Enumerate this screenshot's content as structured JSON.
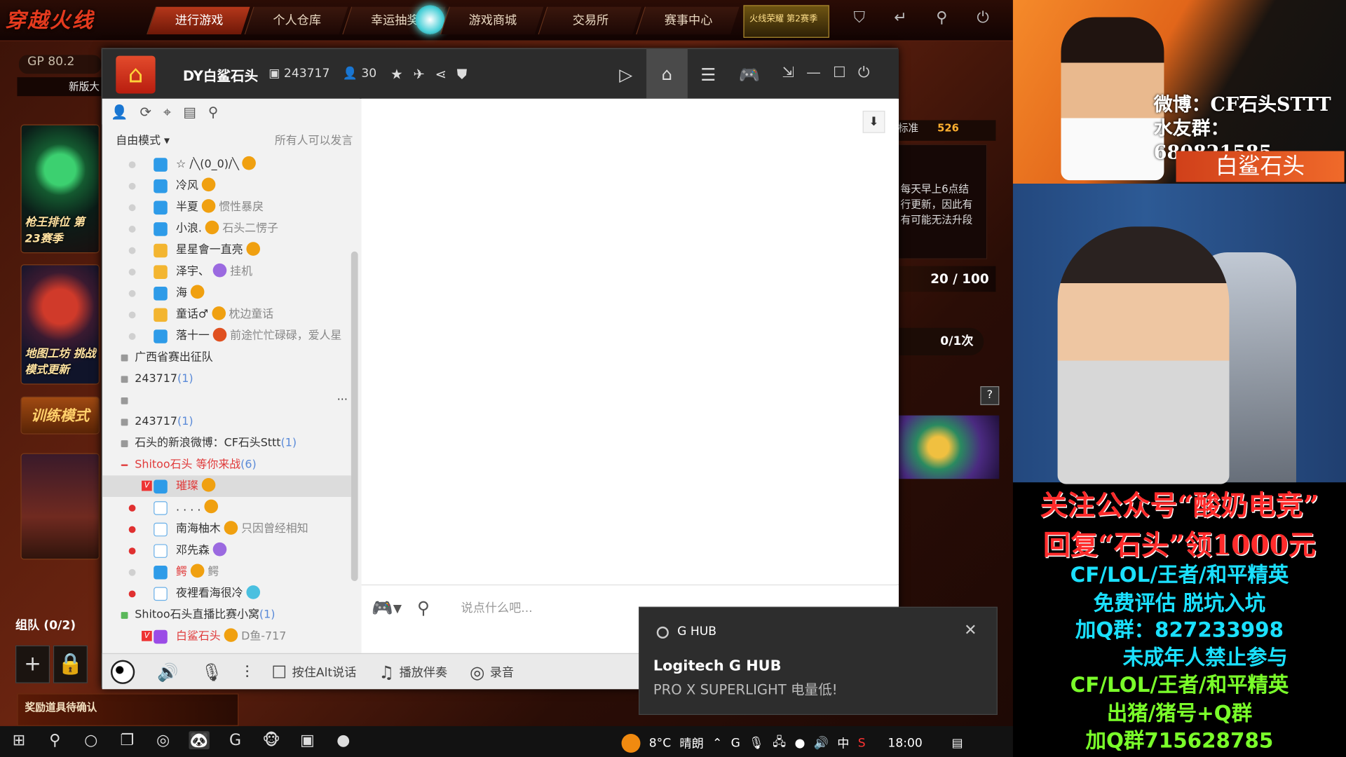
{
  "game": {
    "logo": "穿越火线",
    "tabs": [
      "进行游戏",
      "个人仓库",
      "幸运抽奖",
      "游戏商城",
      "交易所",
      "赛事中心"
    ],
    "active_tab": "进行游戏",
    "event_label": "火线荣耀 第2赛季",
    "gp_label": "GP",
    "gp_value": "80.2",
    "new_version": "新版大",
    "cards": [
      "枪王排位 第23赛季",
      "地图工坊 挑战模式更新",
      "训练模式"
    ],
    "team_label": "组队 (0/2)",
    "reward_text": "奖励道具待确认",
    "right_std_label": "标准",
    "right_std_value": "526",
    "right_box_text_1": "每天早上6点结",
    "right_box_text_2": "行更新，因此有",
    "right_box_text_3": "有可能无法升段",
    "progress_text": "20 / 100",
    "count_text": "0/1次",
    "help_icon": "?"
  },
  "yy": {
    "channel_title": "DY白鲨石头",
    "channel_id": "243717",
    "online_count": "30",
    "mode_label": "自由模式",
    "speak_permission": "所有人可以发言",
    "users_top": [
      {
        "name": "☆ /╲(0_0)/╲",
        "sig": "",
        "avatar": "blue",
        "dot": "grey"
      },
      {
        "name": "冷风",
        "sig": "",
        "avatar": "blue",
        "dot": "grey"
      },
      {
        "name": "半夏",
        "sig": "惯性暴戾",
        "avatar": "blue",
        "dot": "grey"
      },
      {
        "name": "小浪.",
        "sig": "石头二愣子",
        "avatar": "blue",
        "dot": "grey"
      },
      {
        "name": "星星會一直亮",
        "sig": "",
        "avatar": "yellow",
        "dot": "grey"
      },
      {
        "name": "泽宇、",
        "sig": "挂机",
        "avatar": "yellow",
        "dot": "grey"
      },
      {
        "name": "海",
        "sig": "",
        "avatar": "blue",
        "dot": "grey"
      },
      {
        "name": "童话♂",
        "sig": "枕边童话",
        "avatar": "yellow",
        "dot": "grey"
      },
      {
        "name": "落十一",
        "sig": "前途忙忙碌碌，爱人星",
        "avatar": "blue",
        "dot": "grey"
      }
    ],
    "channels": [
      {
        "name": "广西省赛出征队",
        "count": ""
      },
      {
        "name": "243717",
        "count": "(1)"
      },
      {
        "name": "",
        "count": ""
      },
      {
        "name": "243717",
        "count": "(1)"
      },
      {
        "name": "石头的新浪微博：CF石头Sttt",
        "count": "(1)"
      },
      {
        "name": "Shitoo石头  等你来战",
        "count": "(6)"
      }
    ],
    "users_bottom": [
      {
        "name": "璀璨",
        "sig": "",
        "avatar": "blue",
        "dot": "none"
      },
      {
        "name": ". . . .",
        "sig": "",
        "avatar": "white",
        "dot": "red"
      },
      {
        "name": "南海柚木",
        "sig": "只因曾经相知",
        "avatar": "white",
        "dot": "red"
      },
      {
        "name": "邓先森",
        "sig": "",
        "avatar": "white",
        "dot": "red"
      },
      {
        "name": "鳄",
        "sig": "鳄",
        "avatar": "blue",
        "dot": "grey"
      },
      {
        "name": "夜裡看海很冷",
        "sig": "",
        "avatar": "white",
        "dot": "red"
      }
    ],
    "channel_last": {
      "name": "Shitoo石头直播比赛小窝",
      "count": "(1)"
    },
    "user_last": {
      "name": "白鲨石头",
      "sig": "D鱼-717"
    },
    "more_dots": "...",
    "input_placeholder": "说点什么吧...",
    "bottom_alt_talk": "按住Alt说话",
    "bottom_music": "播放伴奏",
    "bottom_record": "录音"
  },
  "toast": {
    "app_name": "G HUB",
    "title": "Logitech G HUB",
    "message": "PRO X SUPERLIGHT 电量低!"
  },
  "stream": {
    "weibo": "微博：CF石头STTT",
    "fan_group": "水友群：680821585",
    "name_plate": "白鲨石头",
    "ad_lines": [
      "关注公众号“酸奶电竞”",
      "回复“石头”领1000元",
      "CF/LOL/王者/和平精英",
      "免费评估  脱坑入坑",
      "加Q群：827233998",
      "未成年人禁止参与",
      "CF/LOL/王者/和平精英",
      "出猪/猪号+Q群",
      "加Q群715628785"
    ]
  },
  "taskbar": {
    "weather_temp": "8°C",
    "weather_desc": "晴朗",
    "ime": "中",
    "time": "18:00"
  }
}
